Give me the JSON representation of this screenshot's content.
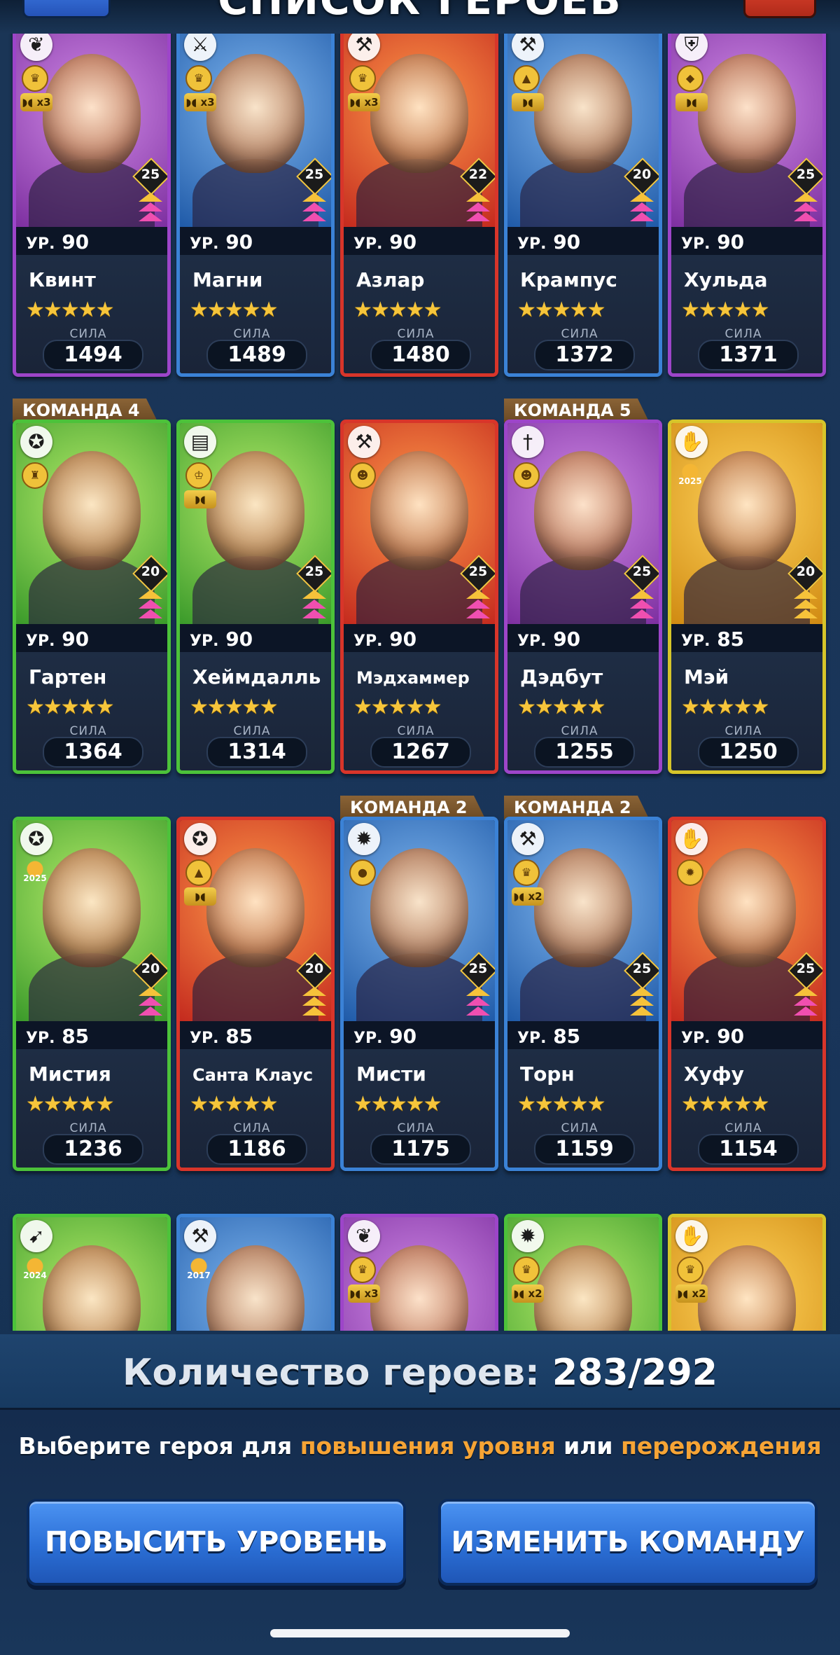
{
  "header": {
    "title": "СПИСОК ГЕРОЕВ"
  },
  "heroes": [
    {
      "name": "Квинт",
      "level": "90",
      "tier": "25",
      "power": "1494",
      "frame": "purple",
      "class_icon": "leaf-icon",
      "badges": [
        "trophy-icon",
        "mask-icon"
      ],
      "mask_count": "x3",
      "chev": "pink"
    },
    {
      "name": "Магни",
      "level": "90",
      "tier": "25",
      "power": "1489",
      "frame": "blue",
      "class_icon": "swords-icon",
      "badges": [
        "trophy-icon",
        "mask-icon"
      ],
      "mask_count": "x3",
      "chev": "pink"
    },
    {
      "name": "Азлар",
      "level": "90",
      "tier": "22",
      "power": "1480",
      "frame": "red",
      "class_icon": "axe-icon",
      "badges": [
        "trophy-icon",
        "mask-icon"
      ],
      "mask_count": "x3",
      "chev": "pink"
    },
    {
      "name": "Крампус",
      "level": "90",
      "tier": "20",
      "power": "1372",
      "frame": "blue",
      "class_icon": "axe-icon",
      "badges": [
        "hat-icon",
        "mask-icon"
      ],
      "mask_count": "",
      "chev": "pink"
    },
    {
      "name": "Хульда",
      "level": "90",
      "tier": "25",
      "power": "1371",
      "frame": "purple",
      "class_icon": "shield-icon",
      "badges": [
        "gem-icon",
        "mask-icon"
      ],
      "mask_count": "",
      "chev": "pink"
    },
    {
      "name": "Гартен",
      "level": "90",
      "tier": "20",
      "power": "1364",
      "frame": "green",
      "class_icon": "pentagram-icon",
      "badges": [
        "castle-icon"
      ],
      "mask_count": "",
      "chev": "pink",
      "team": "КОМАНДА 4"
    },
    {
      "name": "Хеймдалль",
      "level": "90",
      "tier": "25",
      "power": "1314",
      "frame": "green",
      "class_icon": "book-icon",
      "badges": [
        "crown-icon",
        "mask-icon"
      ],
      "mask_count": "",
      "chev": "pink"
    },
    {
      "name": "Мэдхаммер",
      "level": "90",
      "tier": "25",
      "power": "1267",
      "frame": "red",
      "class_icon": "axe-icon",
      "badges": [
        "goblin-icon"
      ],
      "mask_count": "",
      "chev": "pink",
      "small": true
    },
    {
      "name": "Дэдбут",
      "level": "90",
      "tier": "25",
      "power": "1255",
      "frame": "purple",
      "class_icon": "dagger-icon",
      "badges": [
        "goblin-icon"
      ],
      "mask_count": "",
      "chev": "pink",
      "team": "КОМАНДА 5"
    },
    {
      "name": "Мэй",
      "level": "85",
      "tier": "20",
      "power": "1250",
      "frame": "yellow",
      "class_icon": "hand-icon",
      "badges": [],
      "year": "2025",
      "mask_count": "",
      "chev": "gold"
    },
    {
      "name": "Мистия",
      "level": "85",
      "tier": "20",
      "power": "1236",
      "frame": "green",
      "class_icon": "pentagram-icon",
      "badges": [],
      "year": "2025",
      "mask_count": "",
      "chev": "pink"
    },
    {
      "name": "Санта Клаус",
      "level": "85",
      "tier": "20",
      "power": "1186",
      "frame": "red",
      "class_icon": "pentagram-icon",
      "badges": [
        "hat-icon",
        "mask-icon"
      ],
      "mask_count": "",
      "chev": "gold",
      "small": true
    },
    {
      "name": "Мисти",
      "level": "90",
      "tier": "25",
      "power": "1175",
      "frame": "blue",
      "class_icon": "sun-icon",
      "badges": [
        "ball-icon"
      ],
      "mask_count": "",
      "chev": "pink",
      "team": "КОМАНДА 2"
    },
    {
      "name": "Торн",
      "level": "85",
      "tier": "25",
      "power": "1159",
      "frame": "blue",
      "class_icon": "axe-icon",
      "badges": [
        "trophy-icon",
        "mask-icon"
      ],
      "mask_count": "x2",
      "chev": "gold",
      "team": "КОМАНДА 2"
    },
    {
      "name": "Хуфу",
      "level": "90",
      "tier": "25",
      "power": "1154",
      "frame": "red",
      "class_icon": "hand-icon",
      "badges": [
        "sun-icon"
      ],
      "mask_count": "",
      "chev": "pink"
    },
    {
      "name": "",
      "level": "",
      "tier": "",
      "power": "",
      "frame": "green",
      "class_icon": "bow-icon",
      "badges": [],
      "year": "2024",
      "mask_count": "",
      "chev": ""
    },
    {
      "name": "",
      "level": "",
      "tier": "",
      "power": "",
      "frame": "blue",
      "class_icon": "axe-icon",
      "badges": [],
      "year": "2017",
      "mask_count": "",
      "chev": ""
    },
    {
      "name": "",
      "level": "",
      "tier": "",
      "power": "",
      "frame": "purple",
      "class_icon": "leaf-icon",
      "badges": [
        "trophy-icon"
      ],
      "mask_count": "x3",
      "chev": ""
    },
    {
      "name": "",
      "level": "",
      "tier": "",
      "power": "",
      "frame": "green",
      "class_icon": "sun-icon",
      "badges": [
        "trophy-icon"
      ],
      "mask_count": "x2",
      "chev": ""
    },
    {
      "name": "",
      "level": "",
      "tier": "",
      "power": "",
      "frame": "yellow",
      "class_icon": "hand-icon",
      "badges": [
        "trophy-icon"
      ],
      "mask_count": "x2",
      "chev": ""
    }
  ],
  "labels": {
    "level_prefix": "УР.",
    "power": "СИЛА"
  },
  "footer": {
    "count_label": "Количество героев:",
    "count_value": "283/292",
    "hint_prefix": "Выберите героя для",
    "hint_level": "повышения уровня",
    "hint_middle": "или",
    "hint_rebirth": "перерождения",
    "level_up_button": "ПОВЫСИТЬ УРОВЕНЬ",
    "change_team_button": "ИЗМЕНИТЬ КОМАНДУ"
  },
  "colors": {
    "accent_orange": "#f6a435",
    "button_blue": "#2b6fd6",
    "background": "#1a3556"
  }
}
